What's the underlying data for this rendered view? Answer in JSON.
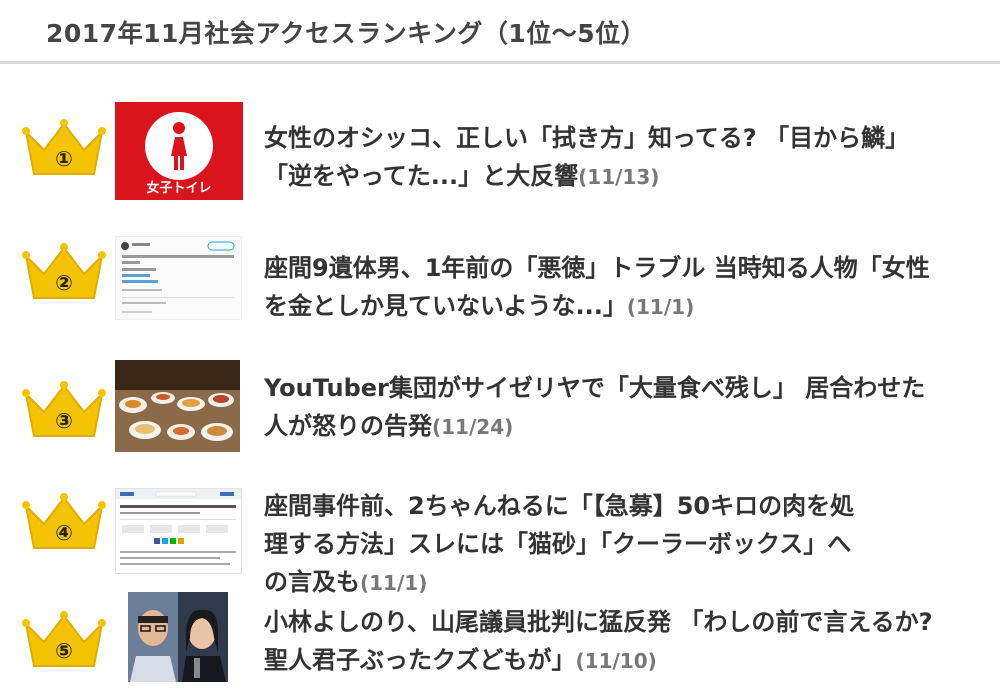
{
  "header": {
    "title": "2017年11月社会アクセスランキング（1位～5位）"
  },
  "ranking": [
    {
      "rank": "①",
      "title": "女性のオシッコ、正しい「拭き方」知ってる? 「目から鱗」「逆をやってた...」と大反響",
      "date": "(11/13)",
      "thumb_text": "女子トイレ"
    },
    {
      "rank": "②",
      "title": "座間9遺体男、1年前の「悪徳」トラブル 当時知る人物「女性を金としか見ていないような...」",
      "date": "(11/1)"
    },
    {
      "rank": "③",
      "title": "YouTuber集団がサイゼリヤで「大量食べ残し」 居合わせた人が怒りの告発",
      "date": "(11/24)"
    },
    {
      "rank": "④",
      "title": "座間事件前、2ちゃんねるに「【急募】50キロの肉を処理する方法」スレには「猫砂」「クーラーボックス」への言及も",
      "date": "(11/1)"
    },
    {
      "rank": "⑤",
      "title": "小林よしのり、山尾議員批判に猛反発 「わしの前で言えるか?聖人君子ぶったクズどもが」",
      "date": "(11/10)"
    }
  ],
  "colors": {
    "crown": "#f5c400",
    "crown_stroke": "#e0ac00",
    "header_rule": "#d9d9d9"
  }
}
